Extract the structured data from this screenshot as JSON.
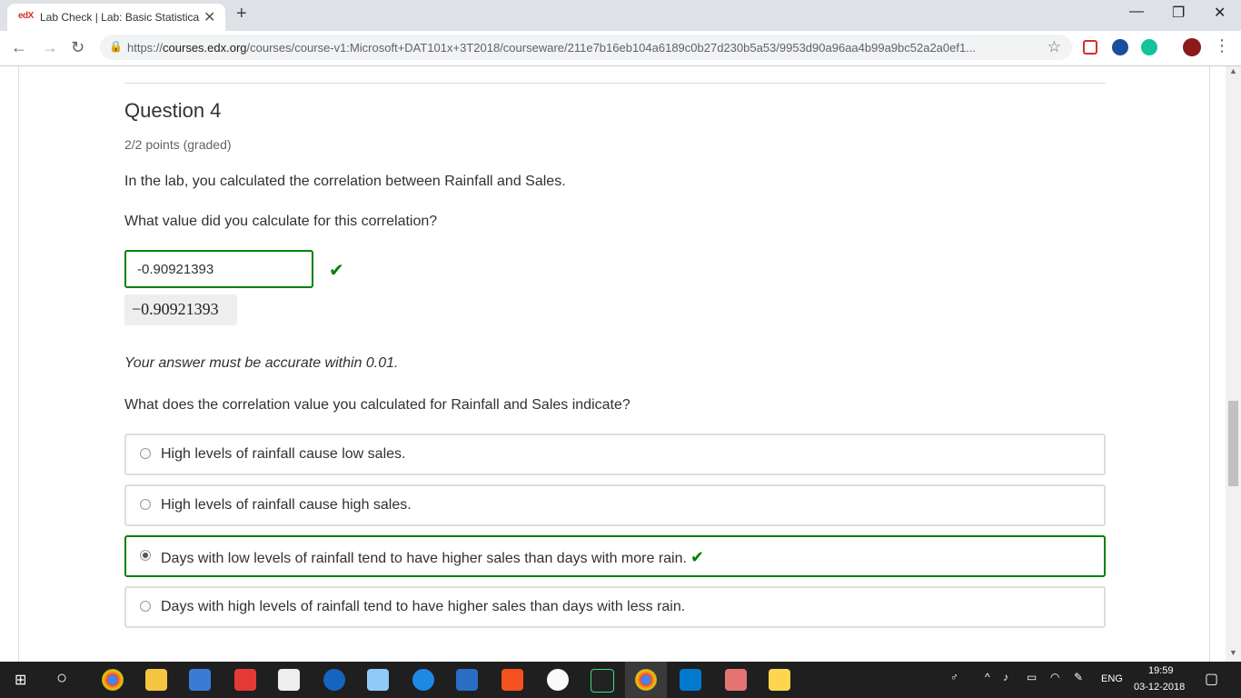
{
  "browser": {
    "tab_title": "Lab Check | Lab: Basic Statistical",
    "tab_favicon_text": "edX",
    "url_host": "courses.edx.org",
    "url_prefix": "https://",
    "url_path": "/courses/course-v1:Microsoft+DAT101x+3T2018/courseware/211e7b16eb104a6189c0b27d230b5a53/9953d90a96aa4b99a9bc52a2a0ef1..."
  },
  "question": {
    "title": "Question 4",
    "points": "2/2 points (graded)",
    "prompt1": "In the lab, you calculated the correlation between Rainfall and Sales.",
    "prompt2": "What value did you calculate for this correlation?",
    "answer_value": "-0.90921393",
    "answer_preview": "−0.90921393",
    "accuracy_note": "Your answer must be accurate within 0.01.",
    "prompt3": "What does the correlation value you calculated for Rainfall and Sales indicate?",
    "choices": [
      {
        "label": "High levels of rainfall cause low sales.",
        "selected": false,
        "correct": false
      },
      {
        "label": "High levels of rainfall cause high sales.",
        "selected": false,
        "correct": false
      },
      {
        "label": "Days with low levels of rainfall tend to have higher sales than days with more rain.",
        "selected": true,
        "correct": true
      },
      {
        "label": "Days with high levels of rainfall tend to have higher sales than days with less rain.",
        "selected": false,
        "correct": false
      }
    ]
  },
  "taskbar": {
    "language": "ENG",
    "time": "19:59",
    "date": "03-12-2018"
  },
  "colors": {
    "correct_green": "#008100",
    "tabbar_bg": "#dee1e6",
    "taskbar_bg": "#1f1f1f"
  }
}
